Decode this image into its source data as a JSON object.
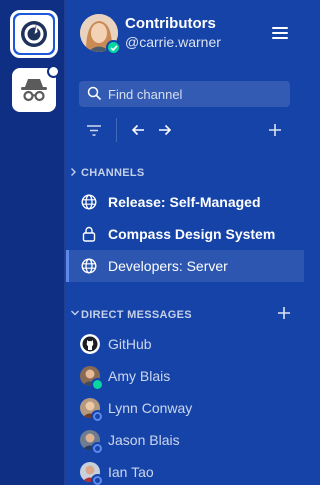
{
  "colors": {
    "sidebar_bg": "#1543a8",
    "team_bg": "#0f2f85",
    "online": "#06d6a0",
    "away": "#5d89ea"
  },
  "header": {
    "team_name": "Contributors",
    "username": "@carrie.warner"
  },
  "search": {
    "placeholder": "Find channel"
  },
  "channels": {
    "title": "CHANNELS",
    "items": [
      {
        "label": "Release: Self-Managed",
        "icon": "globe-icon",
        "unread": true
      },
      {
        "label": "Compass Design System",
        "icon": "lock-icon",
        "unread": true
      },
      {
        "label": "Developers: Server",
        "icon": "globe-icon",
        "active": true
      }
    ]
  },
  "direct_messages": {
    "title": "DIRECT MESSAGES",
    "items": [
      {
        "label": "GitHub",
        "icon": "github-icon"
      },
      {
        "label": "Amy Blais",
        "status": "online"
      },
      {
        "label": "Lynn Conway",
        "status": "away"
      },
      {
        "label": "Jason Blais",
        "status": "away"
      },
      {
        "label": "Ian Tao",
        "status": "away"
      }
    ]
  }
}
